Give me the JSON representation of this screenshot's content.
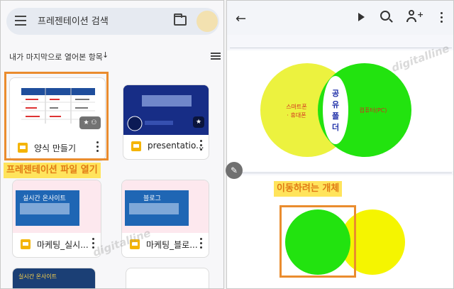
{
  "left_panel": {
    "search_placeholder": "프레젠테이션 검색",
    "recent_label": "내가 마지막으로 열어본 항목",
    "sort_arrow": "↓",
    "files": [
      {
        "name": "양식 만들기"
      },
      {
        "name": "presentatio..."
      },
      {
        "name": "마케팅_실시..."
      },
      {
        "name": "마케팅_블로..."
      }
    ],
    "thumb3_title": "실시간 온사이트",
    "thumb4_title": "블로그",
    "thumb5_title": "실시간 온사이트",
    "caption": "프레젠테이션 파일 열기"
  },
  "right_panel": {
    "slide1": {
      "left_circle_text_line1": "스마트폰",
      "left_circle_text_line2": "· 휴대폰",
      "center_text": [
        "공",
        "유",
        "폴",
        "더"
      ],
      "right_circle_text": "컴퓨터(PC)"
    },
    "caption": "이동하려는 개체"
  },
  "watermark": "digitalline",
  "colors": {
    "highlight_border": "#ea8c2e",
    "caption_bg": "#ffe45c",
    "caption_text": "#e07a15",
    "venn_yellow": "#ecf23f",
    "venn_green": "#22e30f",
    "slides_icon": "#f4b400"
  },
  "icons": [
    "menu-icon",
    "folder-icon",
    "list-view-icon",
    "more-vert-icon",
    "back-arrow-icon",
    "play-icon",
    "search-icon",
    "add-person-icon",
    "pen-icon",
    "star-icon",
    "people-icon"
  ]
}
